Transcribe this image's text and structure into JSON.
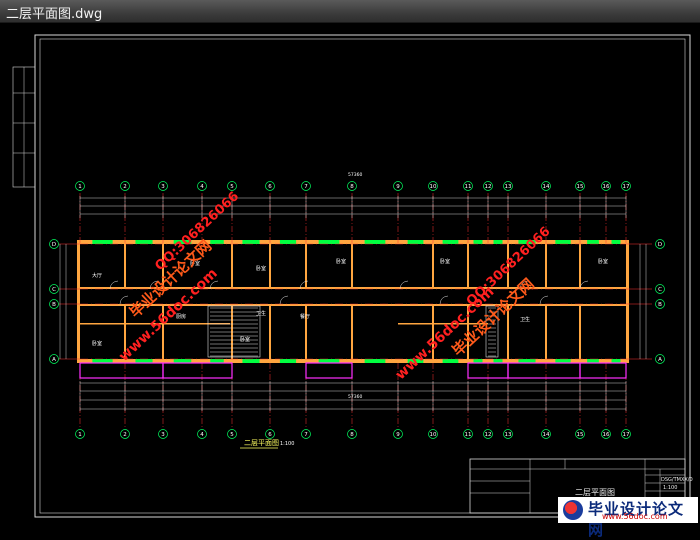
{
  "window": {
    "title": "二层平面图.dwg"
  },
  "axes": {
    "columns": [
      "1",
      "2",
      "3",
      "4",
      "5",
      "6",
      "7",
      "8",
      "9",
      "10",
      "11",
      "12",
      "13",
      "14",
      "15",
      "16",
      "17"
    ],
    "rows": [
      "D",
      "C",
      "B",
      "A"
    ]
  },
  "dimensions": {
    "total": "57360"
  },
  "rooms": {
    "labels": [
      "大厅",
      "卧室",
      "卧室",
      "卧室",
      "卧室",
      "厨房",
      "卫生",
      "卧室",
      "餐厅",
      "卫生",
      "卧室",
      "卧室"
    ]
  },
  "drawing_title": "二层平面图",
  "drawing_scale": "1:100",
  "title_block": {
    "sheet_name": "二层平面图",
    "code": "DSG/TMXX/0",
    "scale_value": "1:100"
  },
  "watermark": {
    "brand": "毕业设计论文网",
    "site": "www.56doc.com",
    "qq": "QQ:306826066"
  },
  "footer_logo": {
    "brand": "毕业设计论文网",
    "site": "www.56doc.com"
  },
  "colors": {
    "background": "#000000",
    "axis_line": "#ff3030",
    "wall": "#ffa640",
    "window": "#00ff40",
    "balcony": "#ff30ff",
    "dimension": "#ffffff",
    "watermark_red": "#ff2020",
    "watermark_brand": "#ff5a1a"
  }
}
